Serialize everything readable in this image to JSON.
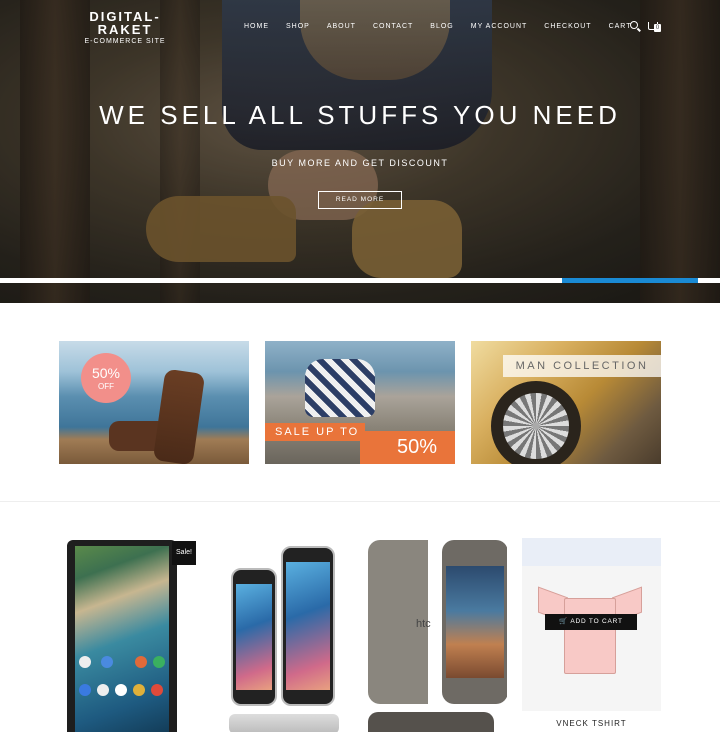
{
  "brand": {
    "line1": "DIGITAL-",
    "line2": "RAKET",
    "tagline": "E-COMMERCE SITE"
  },
  "nav": {
    "items": [
      "HOME",
      "SHOP",
      "ABOUT",
      "CONTACT",
      "BLOG",
      "MY ACCOUNT",
      "CHECKOUT",
      "CART"
    ],
    "search_icon": "search-icon",
    "cart_icon": "cart-icon",
    "cart_count": "0"
  },
  "hero": {
    "title": "WE SELL ALL STUFFS YOU NEED",
    "subtitle": "BUY MORE AND GET DISCOUNT",
    "button": "READ MORE",
    "slider_progress_percent": 19,
    "accent_color": "#1a8ad4"
  },
  "banners": [
    {
      "badge_pct": "50%",
      "badge_text": "OFF",
      "badge_color": "#f28f8a"
    },
    {
      "sale_text": "SALE UP TO",
      "sale_pct": "50%",
      "strip_color": "#e9743a"
    },
    {
      "label": "MAN COLLECTION"
    }
  ],
  "products": [
    {
      "badge": "Sale!"
    },
    {},
    {
      "brand_mark": "htc"
    },
    {
      "button": "ADD TO CART",
      "name": "VNECK TSHIRT"
    }
  ]
}
